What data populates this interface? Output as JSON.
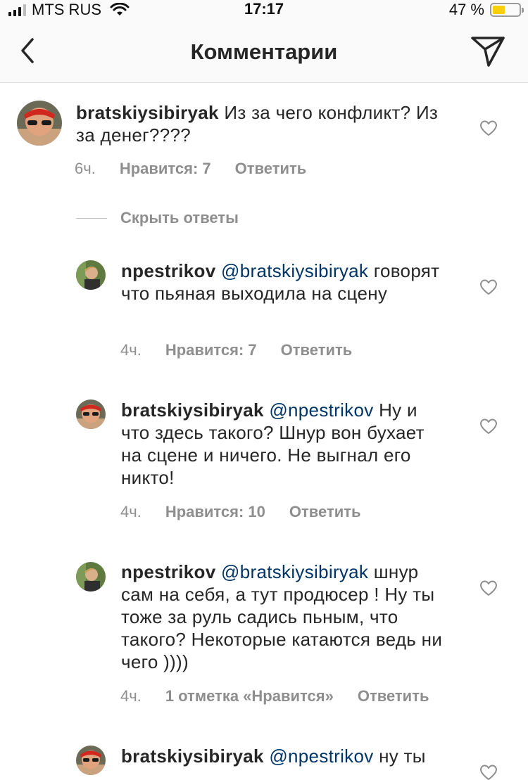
{
  "status_bar": {
    "carrier": "MTS RUS",
    "time": "17:17",
    "battery": "47 %",
    "battery_level": 0.47,
    "colors": {
      "battery_fill": "#f7cf0a"
    }
  },
  "nav": {
    "title": "Комментарии",
    "back_icon": "chevron-left-icon",
    "send_icon": "paper-plane-icon"
  },
  "comments": [
    {
      "username": "bratskiysibiryak",
      "mention": "",
      "text": "Из за чего конфликт? Из за денег????",
      "time": "6ч.",
      "likes": "Нравится: 7",
      "reply": "Ответить"
    },
    {
      "username": "npestrikov",
      "mention": "@bratskiysibiryak",
      "text": "говорят что пьяная выходила на сцену",
      "time": "4ч.",
      "likes": "Нравится: 7",
      "reply": "Ответить"
    },
    {
      "username": "bratskiysibiryak",
      "mention": "@npestrikov",
      "text": "Ну и что здесь такого? Шнур вон бухает на сцене и ничего. Не выгнал его никто!",
      "time": "4ч.",
      "likes": "Нравится: 10",
      "reply": "Ответить"
    },
    {
      "username": "npestrikov",
      "mention": "@bratskiysibiryak",
      "text": "шнур сам на себя, а тут продюсер ! Ну ты тоже за руль садись пьным, что такого? Некоторые катаются ведь ни чего ))))",
      "time": "4ч.",
      "likes": "1 отметка «Нравится»",
      "reply": "Ответить"
    },
    {
      "username": "bratskiysibiryak",
      "mention": "@npestrikov",
      "text": "ну ты"
    }
  ],
  "hide_replies": "Скрыть ответы",
  "colors": {
    "mention": "#003569",
    "meta": "#8e8e8e",
    "text": "#262626"
  }
}
